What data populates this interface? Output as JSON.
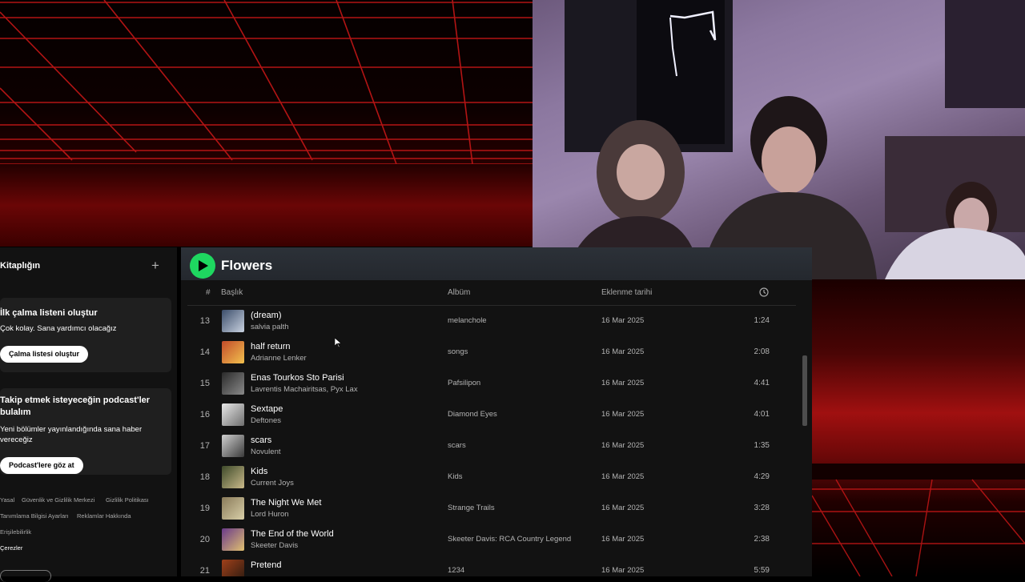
{
  "library": {
    "header": "Kitaplığın",
    "add_icon": "plus-icon",
    "card1": {
      "title": "İlk çalma listeni oluştur",
      "subtitle": "Çok kolay. Sana yardımcı olacağız",
      "button": "Çalma listesi oluştur"
    },
    "card2": {
      "title": "Takip etmek isteyeceğin podcast'ler bulalım",
      "subtitle": "Yeni bölümler yayınlandığında sana haber vereceğiz",
      "button": "Podcast'lere göz at"
    },
    "footer": {
      "yasal": "Yasal",
      "guvenlik": "Güvenlik ve Gizlilik Merkezi",
      "gizlilik": "Gizlilik Politikası",
      "tanimlama": "Tanımlama Bilgisi Ayarları",
      "reklamlar": "Reklamlar Hakkında",
      "erisilebilirlik": "Erişilebilirlik",
      "cerezler": "Çerezler"
    }
  },
  "playlist": {
    "title": "Flowers",
    "columns": {
      "num": "#",
      "title": "Başlık",
      "album": "Albüm",
      "date": "Eklenme tarihi",
      "duration_icon": "clock-icon"
    },
    "accent": "#1ed760",
    "tracks": [
      {
        "num": "13",
        "title": "(dream)",
        "artist": "salvia palth",
        "album": "melanchole",
        "date": "16 Mar 2025",
        "duration": "1:24"
      },
      {
        "num": "14",
        "title": "half return",
        "artist": "Adrianne Lenker",
        "album": "songs",
        "date": "16 Mar 2025",
        "duration": "2:08"
      },
      {
        "num": "15",
        "title": "Enas Tourkos Sto Parisi",
        "artist": "Lavrentis Machairitsas, Pyx Lax",
        "album": "Pafsilipon",
        "date": "16 Mar 2025",
        "duration": "4:41"
      },
      {
        "num": "16",
        "title": "Sextape",
        "artist": "Deftones",
        "album": "Diamond Eyes",
        "date": "16 Mar 2025",
        "duration": "4:01"
      },
      {
        "num": "17",
        "title": "scars",
        "artist": "Novulent",
        "album": "scars",
        "date": "16 Mar 2025",
        "duration": "1:35"
      },
      {
        "num": "18",
        "title": "Kids",
        "artist": "Current Joys",
        "album": "Kids",
        "date": "16 Mar 2025",
        "duration": "4:29"
      },
      {
        "num": "19",
        "title": "The Night We Met",
        "artist": "Lord Huron",
        "album": "Strange Trails",
        "date": "16 Mar 2025",
        "duration": "3:28"
      },
      {
        "num": "20",
        "title": "The End of the World",
        "artist": "Skeeter Davis",
        "album": "Skeeter Davis: RCA Country Legend",
        "date": "16 Mar 2025",
        "duration": "2:38"
      },
      {
        "num": "21",
        "title": "Pretend",
        "artist": "",
        "album": "1234",
        "date": "16 Mar 2025",
        "duration": "5:59"
      }
    ]
  }
}
